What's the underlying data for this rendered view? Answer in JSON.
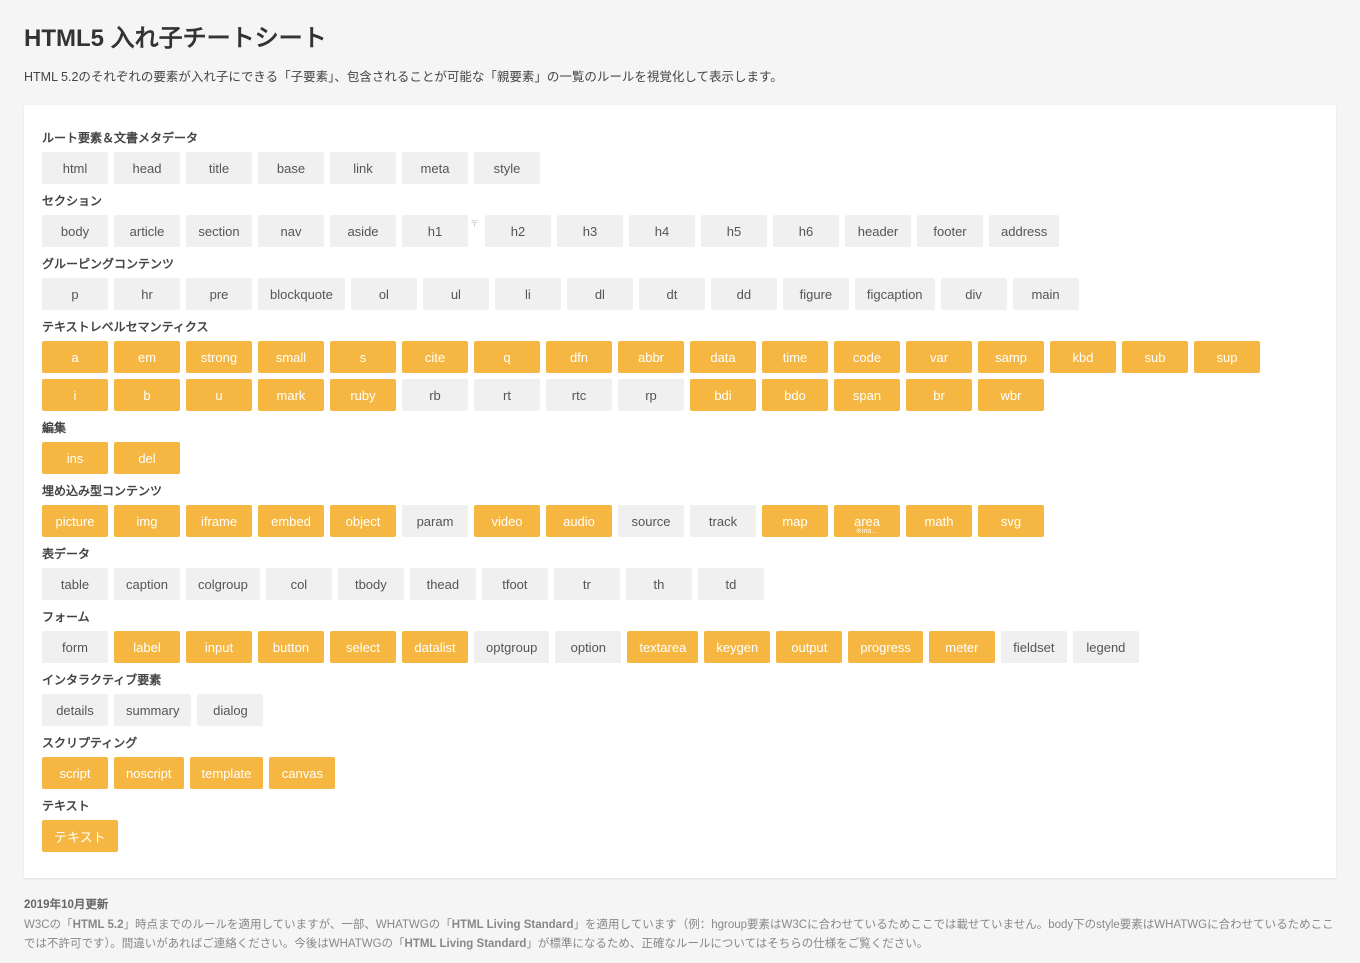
{
  "title": "HTML5 入れ子チートシート",
  "lead": "HTML 5.2のそれぞれの要素が入れ子にできる「子要素」、包含されることが可能な「親要素」の一覧のルールを視覚化して表示します。",
  "sections": [
    {
      "title": "ルート要素＆文書メタデータ",
      "tags": [
        {
          "label": "html",
          "kind": "gray"
        },
        {
          "label": "head",
          "kind": "gray"
        },
        {
          "label": "title",
          "kind": "gray"
        },
        {
          "label": "base",
          "kind": "gray"
        },
        {
          "label": "link",
          "kind": "gray"
        },
        {
          "label": "meta",
          "kind": "gray"
        },
        {
          "label": "style",
          "kind": "gray"
        }
      ]
    },
    {
      "title": "セクション",
      "tags": [
        {
          "label": "body",
          "kind": "gray"
        },
        {
          "label": "article",
          "kind": "gray"
        },
        {
          "label": "section",
          "kind": "gray"
        },
        {
          "label": "nav",
          "kind": "gray"
        },
        {
          "label": "aside",
          "kind": "gray"
        },
        {
          "label": "h1",
          "kind": "gray",
          "marker": "〒"
        },
        {
          "label": "h2",
          "kind": "gray"
        },
        {
          "label": "h3",
          "kind": "gray"
        },
        {
          "label": "h4",
          "kind": "gray"
        },
        {
          "label": "h5",
          "kind": "gray"
        },
        {
          "label": "h6",
          "kind": "gray"
        },
        {
          "label": "header",
          "kind": "gray"
        },
        {
          "label": "footer",
          "kind": "gray"
        },
        {
          "label": "address",
          "kind": "gray"
        }
      ]
    },
    {
      "title": "グルーピングコンテンツ",
      "tags": [
        {
          "label": "p",
          "kind": "gray"
        },
        {
          "label": "hr",
          "kind": "gray"
        },
        {
          "label": "pre",
          "kind": "gray"
        },
        {
          "label": "blockquote",
          "kind": "gray"
        },
        {
          "label": "ol",
          "kind": "gray"
        },
        {
          "label": "ul",
          "kind": "gray"
        },
        {
          "label": "li",
          "kind": "gray"
        },
        {
          "label": "dl",
          "kind": "gray"
        },
        {
          "label": "dt",
          "kind": "gray"
        },
        {
          "label": "dd",
          "kind": "gray"
        },
        {
          "label": "figure",
          "kind": "gray"
        },
        {
          "label": "figcaption",
          "kind": "gray"
        },
        {
          "label": "div",
          "kind": "gray"
        },
        {
          "label": "main",
          "kind": "gray"
        }
      ]
    },
    {
      "title": "テキストレベルセマンティクス",
      "tags": [
        {
          "label": "a",
          "kind": "orange"
        },
        {
          "label": "em",
          "kind": "orange"
        },
        {
          "label": "strong",
          "kind": "orange"
        },
        {
          "label": "small",
          "kind": "orange"
        },
        {
          "label": "s",
          "kind": "orange"
        },
        {
          "label": "cite",
          "kind": "orange"
        },
        {
          "label": "q",
          "kind": "orange"
        },
        {
          "label": "dfn",
          "kind": "orange"
        },
        {
          "label": "abbr",
          "kind": "orange"
        },
        {
          "label": "data",
          "kind": "orange"
        },
        {
          "label": "time",
          "kind": "orange"
        },
        {
          "label": "code",
          "kind": "orange"
        },
        {
          "label": "var",
          "kind": "orange"
        },
        {
          "label": "samp",
          "kind": "orange"
        },
        {
          "label": "kbd",
          "kind": "orange"
        },
        {
          "label": "sub",
          "kind": "orange"
        },
        {
          "label": "sup",
          "kind": "orange"
        },
        {
          "label": "i",
          "kind": "orange"
        },
        {
          "label": "b",
          "kind": "orange"
        },
        {
          "label": "u",
          "kind": "orange"
        },
        {
          "label": "mark",
          "kind": "orange"
        },
        {
          "label": "ruby",
          "kind": "orange"
        },
        {
          "label": "rb",
          "kind": "gray"
        },
        {
          "label": "rt",
          "kind": "gray"
        },
        {
          "label": "rtc",
          "kind": "gray"
        },
        {
          "label": "rp",
          "kind": "gray"
        },
        {
          "label": "bdi",
          "kind": "orange"
        },
        {
          "label": "bdo",
          "kind": "orange"
        },
        {
          "label": "span",
          "kind": "orange"
        },
        {
          "label": "br",
          "kind": "orange"
        },
        {
          "label": "wbr",
          "kind": "orange"
        }
      ]
    },
    {
      "title": "編集",
      "tags": [
        {
          "label": "ins",
          "kind": "orange"
        },
        {
          "label": "del",
          "kind": "orange"
        }
      ]
    },
    {
      "title": "埋め込み型コンテンツ",
      "tags": [
        {
          "label": "picture",
          "kind": "orange"
        },
        {
          "label": "img",
          "kind": "orange"
        },
        {
          "label": "iframe",
          "kind": "orange"
        },
        {
          "label": "embed",
          "kind": "orange"
        },
        {
          "label": "object",
          "kind": "orange"
        },
        {
          "label": "param",
          "kind": "gray"
        },
        {
          "label": "video",
          "kind": "orange"
        },
        {
          "label": "audio",
          "kind": "orange"
        },
        {
          "label": "source",
          "kind": "gray"
        },
        {
          "label": "track",
          "kind": "gray"
        },
        {
          "label": "map",
          "kind": "orange"
        },
        {
          "label": "area",
          "kind": "orange",
          "note": "※ma…"
        },
        {
          "label": "math",
          "kind": "orange"
        },
        {
          "label": "svg",
          "kind": "orange"
        }
      ]
    },
    {
      "title": "表データ",
      "tags": [
        {
          "label": "table",
          "kind": "gray"
        },
        {
          "label": "caption",
          "kind": "gray"
        },
        {
          "label": "colgroup",
          "kind": "gray"
        },
        {
          "label": "col",
          "kind": "gray"
        },
        {
          "label": "tbody",
          "kind": "gray"
        },
        {
          "label": "thead",
          "kind": "gray"
        },
        {
          "label": "tfoot",
          "kind": "gray"
        },
        {
          "label": "tr",
          "kind": "gray"
        },
        {
          "label": "th",
          "kind": "gray"
        },
        {
          "label": "td",
          "kind": "gray"
        }
      ]
    },
    {
      "title": "フォーム",
      "tags": [
        {
          "label": "form",
          "kind": "gray"
        },
        {
          "label": "label",
          "kind": "orange"
        },
        {
          "label": "input",
          "kind": "orange"
        },
        {
          "label": "button",
          "kind": "orange"
        },
        {
          "label": "select",
          "kind": "orange"
        },
        {
          "label": "datalist",
          "kind": "orange"
        },
        {
          "label": "optgroup",
          "kind": "gray"
        },
        {
          "label": "option",
          "kind": "gray"
        },
        {
          "label": "textarea",
          "kind": "orange"
        },
        {
          "label": "keygen",
          "kind": "orange"
        },
        {
          "label": "output",
          "kind": "orange"
        },
        {
          "label": "progress",
          "kind": "orange"
        },
        {
          "label": "meter",
          "kind": "orange"
        },
        {
          "label": "fieldset",
          "kind": "gray"
        },
        {
          "label": "legend",
          "kind": "gray"
        }
      ]
    },
    {
      "title": "インタラクティブ要素",
      "tags": [
        {
          "label": "details",
          "kind": "gray"
        },
        {
          "label": "summary",
          "kind": "gray"
        },
        {
          "label": "dialog",
          "kind": "gray"
        }
      ]
    },
    {
      "title": "スクリプティング",
      "tags": [
        {
          "label": "script",
          "kind": "orange"
        },
        {
          "label": "noscript",
          "kind": "orange"
        },
        {
          "label": "template",
          "kind": "orange"
        },
        {
          "label": "canvas",
          "kind": "orange"
        }
      ]
    },
    {
      "title": "テキスト",
      "tags": [
        {
          "label": "テキスト",
          "kind": "orange"
        }
      ]
    }
  ],
  "footer": {
    "date": "2019年10月更新",
    "text_a": "W3Cの「",
    "bold1": "HTML 5.2",
    "text_b": "」時点までのルールを適用していますが、一部、WHATWGの「",
    "bold2": "HTML Living Standard",
    "text_c": "」を適用しています（例：hgroup要素はW3Cに合わせているためここでは載せていません。body下のstyle要素はWHATWGに合わせているためここでは不許可です）。間違いがあればご連絡ください。今後はWHATWGの「",
    "bold3": "HTML Living Standard",
    "text_d": "」が標準になるため、正確なルールについてはそちらの仕様をご覧ください。"
  }
}
